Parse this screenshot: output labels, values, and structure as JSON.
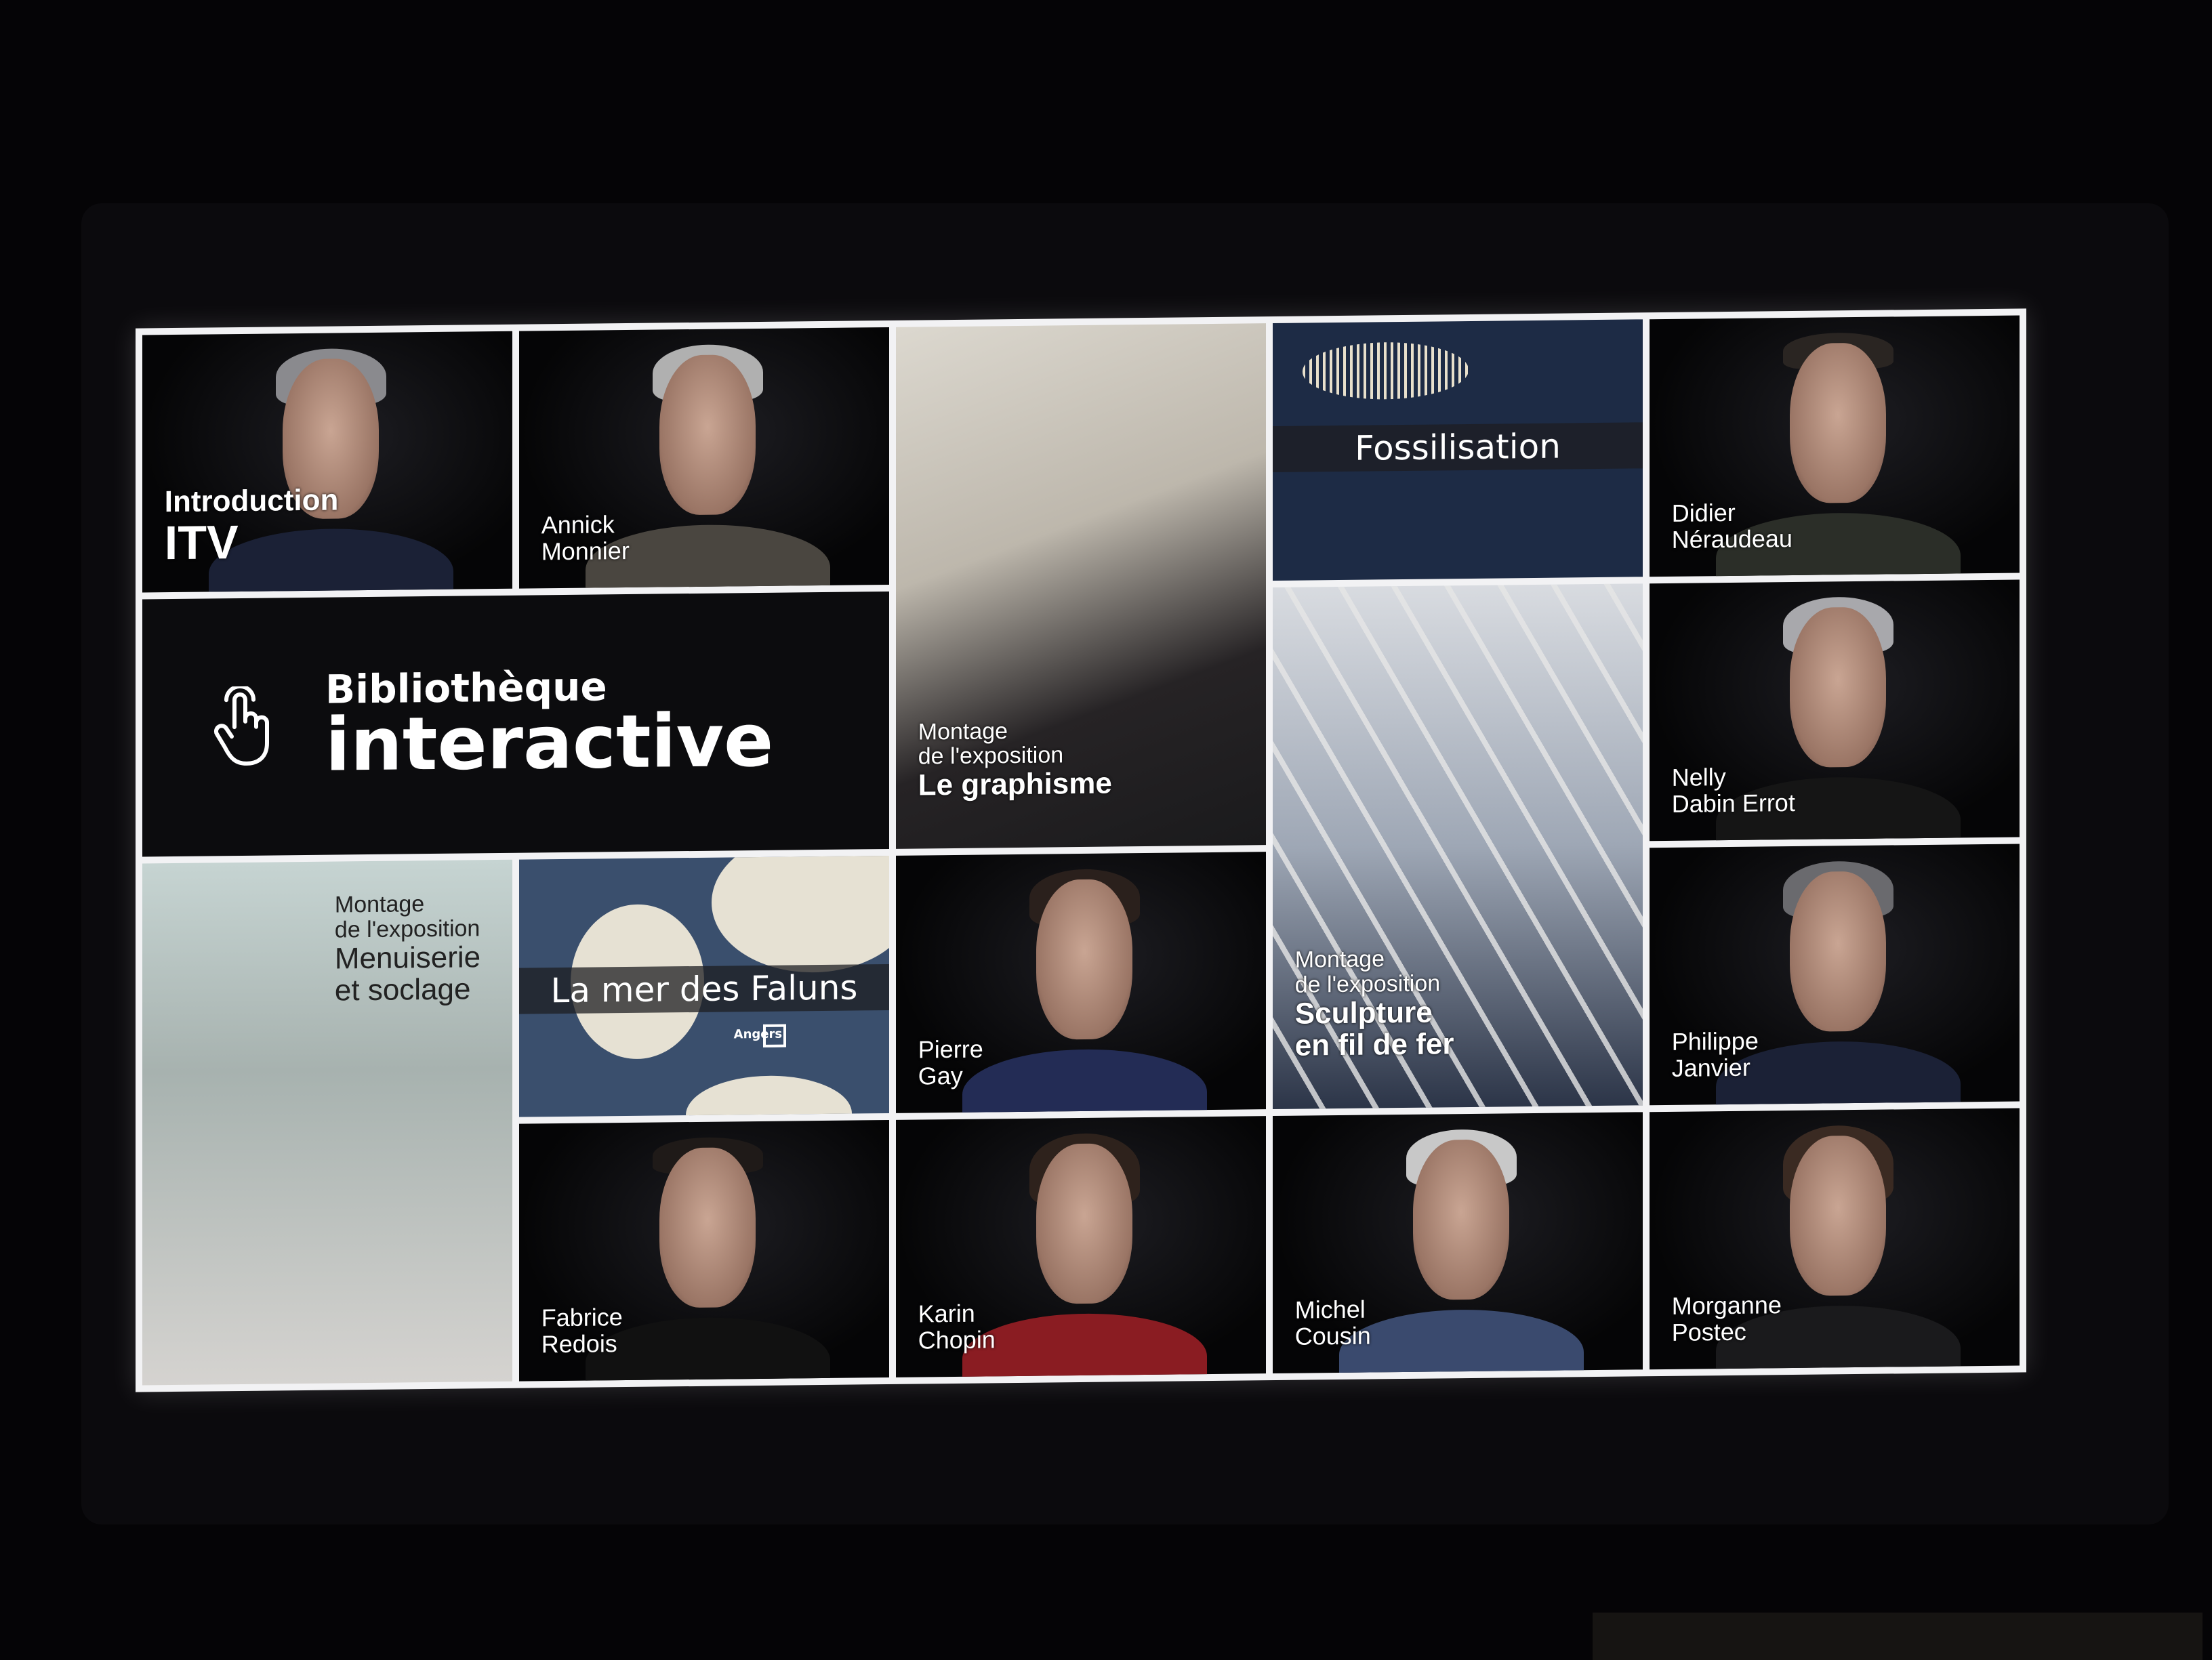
{
  "screen_title": "Bibliothèque interactive",
  "tiles": {
    "intro": {
      "line1": "Introduction",
      "line2": "ITV"
    },
    "annick": {
      "first": "Annick",
      "last": "Monnier"
    },
    "graphisme": {
      "line1": "Montage",
      "line2": "de l'exposition",
      "title": "Le graphisme"
    },
    "fossil": {
      "title": "Fossilisation"
    },
    "didier": {
      "first": "Didier",
      "last": "Néraudeau"
    },
    "biblio": {
      "line1": "Bibliothèque",
      "line2": "interactive",
      "icon": "touch-hand-icon"
    },
    "sculpture": {
      "line1": "Montage",
      "line2": "de l'exposition",
      "title1": "Sculpture",
      "title2": "en fil de fer"
    },
    "nelly": {
      "first": "Nelly",
      "last": "Dabin Errot"
    },
    "menuiserie": {
      "line1": "Montage",
      "line2": "de l'exposition",
      "title1": "Menuiserie",
      "title2": "et soclage"
    },
    "faluns": {
      "title": "La mer des Faluns",
      "map_label": "Angers"
    },
    "pierre": {
      "first": "Pierre",
      "last": "Gay"
    },
    "philippe": {
      "first": "Philippe",
      "last": "Janvier"
    },
    "fabrice": {
      "first": "Fabrice",
      "last": "Redois"
    },
    "karin": {
      "first": "Karin",
      "last": "Chopin"
    },
    "michel": {
      "first": "Michel",
      "last": "Cousin"
    },
    "morganne": {
      "first": "Morganne",
      "last": "Postec"
    }
  },
  "colors": {
    "frame": "#f2f2f4",
    "tile_bg": "#0c0c0e",
    "map_sea": "#3a4f6d",
    "fossil_bg": "#1d2b45"
  }
}
